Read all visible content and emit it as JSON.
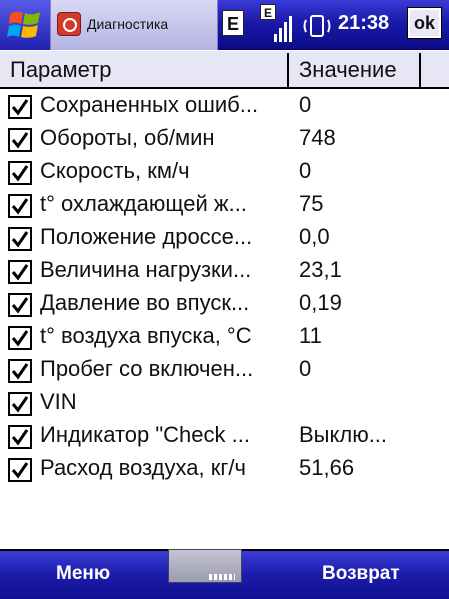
{
  "titlebar": {
    "app_title": "Диагностика",
    "status_e1": "E",
    "status_e2": "E",
    "clock": "21:38",
    "ok_label": "ok"
  },
  "list": {
    "headers": {
      "param": "Параметр",
      "value": "Значение"
    },
    "rows": [
      {
        "param": "Сохраненных ошиб...",
        "value": "0"
      },
      {
        "param": "Обороты, об/мин",
        "value": "748"
      },
      {
        "param": "Скорость, км/ч",
        "value": "0"
      },
      {
        "param": "t° охлаждающей ж...",
        "value": "75"
      },
      {
        "param": "Положение дроссе...",
        "value": "0,0"
      },
      {
        "param": "Величина нагрузки...",
        "value": "23,1"
      },
      {
        "param": "Давление во впуск...",
        "value": "0,19"
      },
      {
        "param": "t° воздуха впуска, °C",
        "value": "11"
      },
      {
        "param": "Пробег со включен...",
        "value": "0"
      },
      {
        "param": "VIN",
        "value": ""
      },
      {
        "param": "Индикатор \"Check ...",
        "value": "Выклю..."
      },
      {
        "param": "Расход воздуха, кг/ч",
        "value": "51,66"
      }
    ]
  },
  "softkeys": {
    "left": "Меню",
    "right": "Возврат"
  },
  "colors": {
    "accent": "#1a1aa8",
    "header_bg": "#e6e6f4"
  }
}
